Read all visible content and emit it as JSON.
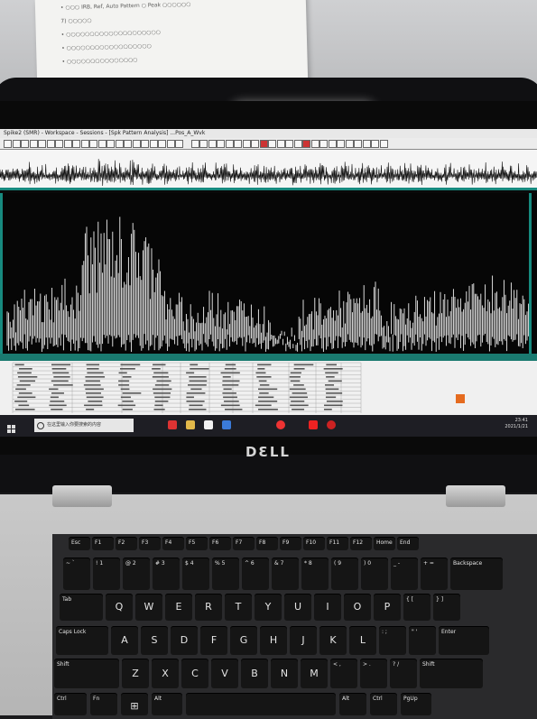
{
  "paper": {
    "lines": [
      "• ○○○ IRB, Ref, Auto Pattern ○ Peak ○○○○○○",
      "7) ○○○○○",
      "• ○○○○○○○○○○○○○○○○○○○○",
      "• ○○○○○○○○○○○○○○○○○○",
      "• ○○○○○○○○○○○○○○○"
    ]
  },
  "app": {
    "title": "Spike2 (SMR) - Workspace - Sessions - [Spk Pattern Analysis] ...Pos_A_Wvk",
    "search_placeholder": "在这里输入你要搜索的内容",
    "clock_time": "23:41",
    "clock_date": "2021/1/21"
  },
  "brand": {
    "logo": "DƐLL"
  },
  "keyboard": {
    "rows": [
      [
        "Esc",
        "F1",
        "F2",
        "F3",
        "F4",
        "F5",
        "F6",
        "F7",
        "F8",
        "F9",
        "F10",
        "F11",
        "F12",
        "Home",
        "End"
      ],
      [
        "~ `",
        "! 1",
        "@ 2",
        "# 3",
        "$ 4",
        "% 5",
        "^ 6",
        "& 7",
        "* 8",
        "( 9",
        ") 0",
        "_ -",
        "+ =",
        "Backspace"
      ],
      [
        "Tab",
        "Q",
        "W",
        "E",
        "R",
        "T",
        "Y",
        "U",
        "I",
        "O",
        "P",
        "{ [",
        "} ]"
      ],
      [
        "Caps Lock",
        "A",
        "S",
        "D",
        "F",
        "G",
        "H",
        "J",
        "K",
        "L",
        ": ;",
        "\" '",
        "Enter"
      ],
      [
        "Shift",
        "Z",
        "X",
        "C",
        "V",
        "B",
        "N",
        "M",
        "< ,",
        "> .",
        "? /",
        "Shift"
      ],
      [
        "Ctrl",
        "Fn",
        "⊞",
        "Alt",
        "",
        "Alt",
        "Ctrl",
        "PgUp"
      ]
    ]
  },
  "colors": {
    "teal": "#178a7f",
    "screen_bg": "#060606",
    "key": "#151515"
  }
}
